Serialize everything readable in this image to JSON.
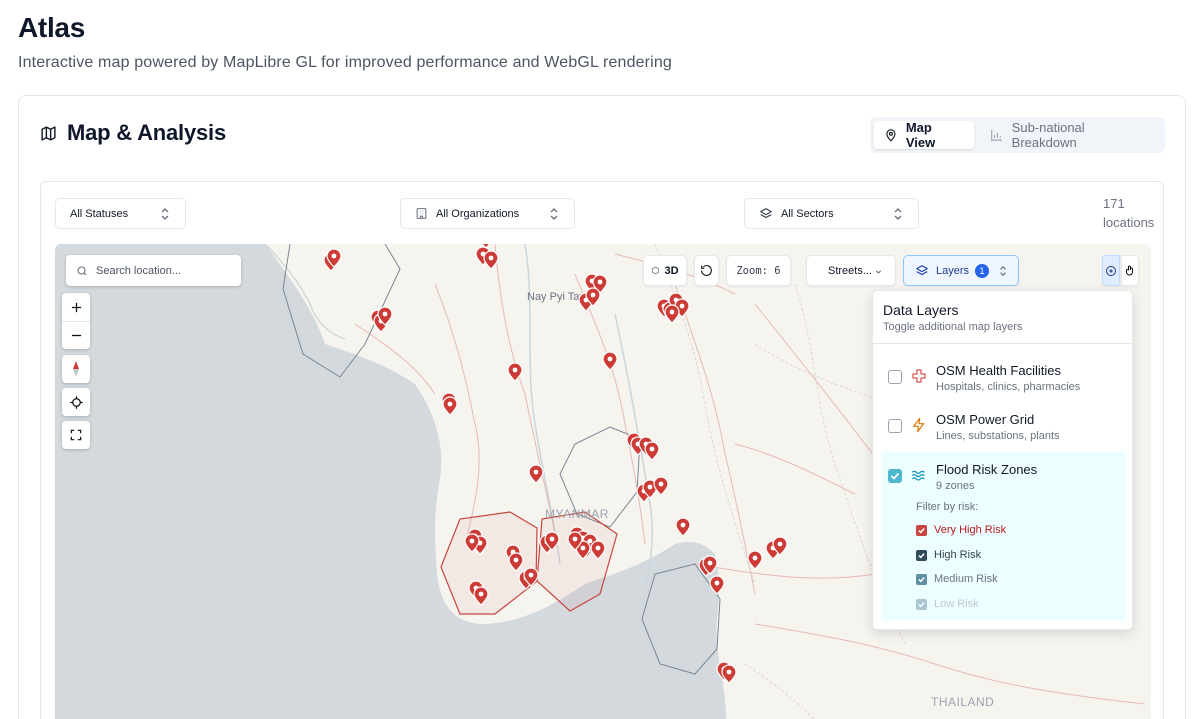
{
  "page": {
    "title": "Atlas",
    "subtitle": "Interactive map powered by MapLibre GL for improved performance and WebGL rendering"
  },
  "card": {
    "title": "Map & Analysis",
    "tabs": [
      {
        "label": "Map View",
        "icon": "map-pin-icon",
        "active": true
      },
      {
        "label": "Sub-national Breakdown",
        "icon": "bar-chart-icon",
        "active": false
      }
    ]
  },
  "filters": {
    "status": "All Statuses",
    "organization": "All Organizations",
    "sector": "All Sectors",
    "location_count": "171 locations"
  },
  "map": {
    "search_placeholder": "Search location...",
    "btn_3d": "3D",
    "zoom_readout": "Zoom: 6",
    "basemap": "Streets...",
    "layers_label": "Layers",
    "layers_count": "1",
    "place_labels": [
      "Nay Pyi Taw",
      "MYANMAR",
      "THAILAND"
    ],
    "colors": {
      "water": "#d3d9dd",
      "land": "#f6f4ef",
      "marker": "#cc3b36",
      "flood_zone": "#c8463f",
      "accent": "#2563eb"
    }
  },
  "layers_panel": {
    "title": "Data Layers",
    "subtitle": "Toggle additional map layers",
    "items": [
      {
        "name": "OSM Health Facilities",
        "desc": "Hospitals, clinics, pharmacies",
        "icon": "health-cross-icon",
        "checked": false
      },
      {
        "name": "OSM Power Grid",
        "desc": "Lines, substations, plants",
        "icon": "lightning-icon",
        "checked": false
      },
      {
        "name": "Flood Risk Zones",
        "desc": "9 zones",
        "icon": "waves-icon",
        "checked": true
      }
    ],
    "filter_label": "Filter by risk:",
    "risks": [
      {
        "label": "Very High Risk",
        "color": "#c8463f",
        "text_color": "#b91c1c"
      },
      {
        "label": "High Risk",
        "color": "#2f4b5c",
        "text_color": "#374151"
      },
      {
        "label": "Medium Risk",
        "color": "#5f8fa3",
        "text_color": "#6b7280"
      },
      {
        "label": "Low Risk",
        "color": "#a9c6d3",
        "text_color": "#c0c7cf"
      }
    ]
  }
}
